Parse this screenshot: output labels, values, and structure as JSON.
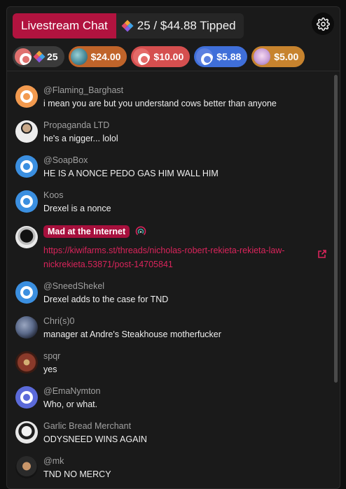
{
  "header": {
    "title": "Livestream Chat",
    "tip_summary": "25 / $44.88 Tipped"
  },
  "tippers": [
    {
      "amount": "25",
      "color": "#3a3a3a",
      "avatar_color": "#e0716f",
      "gem": true
    },
    {
      "amount": "$24.00",
      "color": "#c0642a",
      "avatar_color": "#4a8b9a"
    },
    {
      "amount": "$10.00",
      "color": "#d54f4f",
      "avatar_color": "#e46a68"
    },
    {
      "amount": "$5.88",
      "color": "#3f6fd9",
      "avatar_color": "#5b7fe0"
    },
    {
      "amount": "$5.00",
      "color": "#c7832e",
      "avatar_color": "#c9a0d8"
    }
  ],
  "messages": [
    {
      "user": "@Flaming_Barghast",
      "text": "i mean you are but you understand cows better than anyone",
      "avatar_color": "#f29a4f"
    },
    {
      "user": "Propaganda LTD",
      "text": "he's a nigger... lolol",
      "avatar_color": "#d9d9d9"
    },
    {
      "user": "@SoapBox",
      "text": "HE IS A NONCE PEDO GAS HIM WALL HIM",
      "avatar_color": "#3b8fe0"
    },
    {
      "user": "Koos",
      "text": "Drexel is a nonce",
      "avatar_color": "#3b8fe0"
    },
    {
      "user": "Mad at the Internet",
      "link": "https://kiwifarms.st/threads/nicholas-robert-rekieta-rekieta-law-nickrekieta.53871/post-14705841",
      "avatar_color": "#d8d8d8"
    },
    {
      "user": "@SneedShekel",
      "text": "Drexel adds to the case for TND",
      "avatar_color": "#3b8fe0"
    },
    {
      "user": "Chri(s)0",
      "text": "manager at Andre's Steakhouse motherfucker",
      "avatar_color": "#5b6a8a"
    },
    {
      "user": "spqr",
      "text": "yes",
      "avatar_color": "#8a3a2a"
    },
    {
      "user": "@EmaNymton",
      "text": "Who, or what.",
      "avatar_color": "#5b6ad9"
    },
    {
      "user": "Garlic Bread Merchant",
      "text": "ODYSNEED WINS AGAIN",
      "avatar_color": "#e8e8e8"
    },
    {
      "user": "@mk",
      "text": "TND NO MERCY",
      "avatar_color": "#2a2a2a"
    }
  ]
}
